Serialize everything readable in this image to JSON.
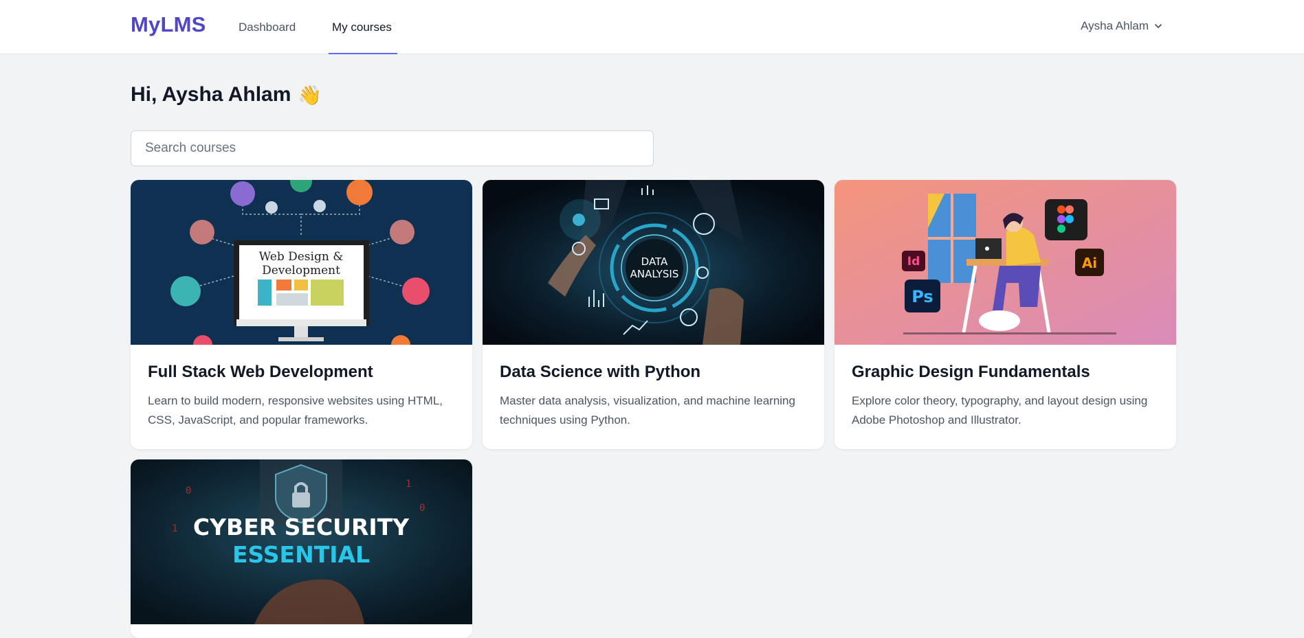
{
  "brand": {
    "logo": "MyLMS",
    "accent": "#4f46c8"
  },
  "nav": {
    "items": [
      {
        "label": "Dashboard",
        "active": false
      },
      {
        "label": "My courses",
        "active": true
      }
    ]
  },
  "user": {
    "name": "Aysha Ahlam",
    "menu_icon": "chevron-down-icon"
  },
  "greeting": {
    "text": "Hi, Aysha Ahlam",
    "emoji": "👋"
  },
  "search": {
    "placeholder": "Search courses",
    "value": ""
  },
  "courses": [
    {
      "title": "Full Stack Web Development",
      "description": "Learn to build modern, responsive websites using HTML, CSS, JavaScript, and popular frameworks.",
      "image_text": [
        "Web Design &",
        "Development"
      ]
    },
    {
      "title": "Data Science with Python",
      "description": "Master data analysis, visualization, and machine learning techniques using Python.",
      "image_text": [
        "DATA",
        "ANALYSIS"
      ]
    },
    {
      "title": "Graphic Design Fundamentals",
      "description": "Explore color theory, typography, and layout design using Adobe Photoshop and Illustrator.",
      "image_text": [
        "Id",
        "Ps",
        "Ai"
      ]
    },
    {
      "title": "",
      "description": "",
      "image_text": [
        "CYBER SECURITY",
        "ESSENTIAL"
      ]
    }
  ]
}
